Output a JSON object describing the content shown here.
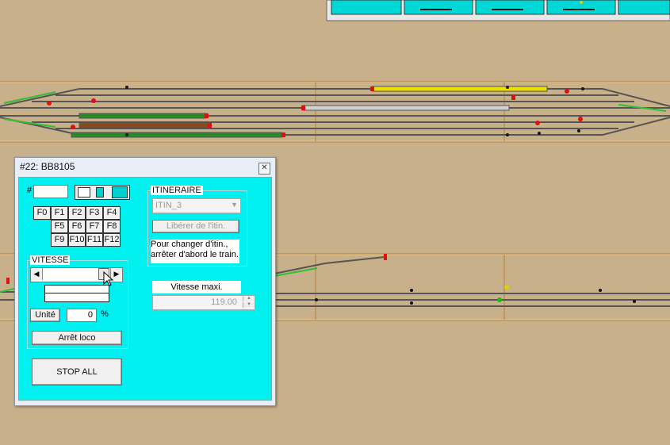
{
  "colors": {
    "background": "#c8b08a",
    "dialog_client": "#00f0f0",
    "track": "#4a4a4a",
    "signal_red": "#e01010",
    "signal_green": "#10c010"
  },
  "dialog": {
    "title": "#22: BB8105",
    "close_icon": "close-icon",
    "address_label": "#",
    "address_value": "",
    "function_keys": [
      "F0",
      "F1",
      "F2",
      "F3",
      "F4",
      "F5",
      "F6",
      "F7",
      "F8",
      "F9",
      "F10",
      "F11",
      "F12"
    ],
    "vitesse": {
      "title": "VITESSE",
      "unit_button": "Unité",
      "speed_value": "0",
      "percent": "%",
      "stop_loco": "Arrêt loco"
    },
    "stop_all": "STOP ALL",
    "itineraire": {
      "title": "ITINERAIRE",
      "selected": "ITIN_3",
      "release_button": "Libérer de l'itin.",
      "note": "Pour changer d'itin., arrêter d'abord le train."
    },
    "vitesse_maxi": {
      "label": "Vitesse maxi.",
      "value": "119.00"
    }
  }
}
